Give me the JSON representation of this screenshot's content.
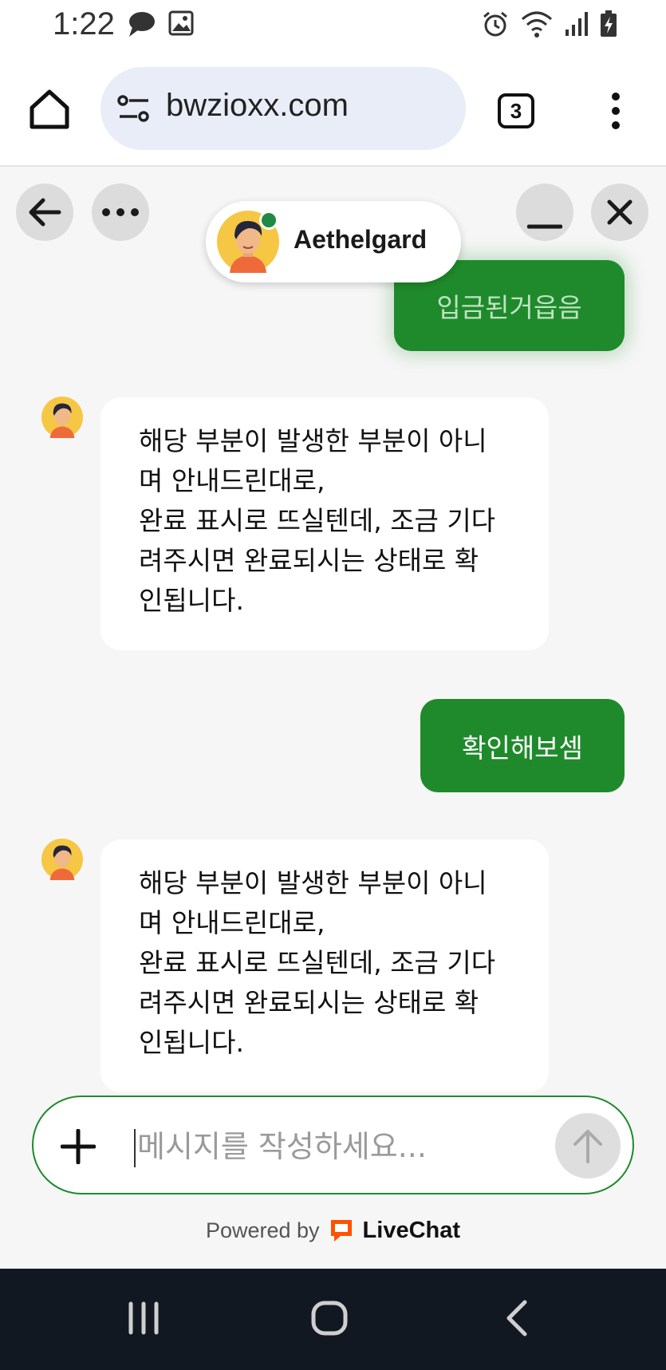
{
  "status_bar": {
    "time": "1:22",
    "left_icons": [
      "chat-bubble-icon",
      "image-icon"
    ],
    "right_icons": [
      "alarm-icon",
      "wifi-icon",
      "signal-icon",
      "battery-charging-icon"
    ]
  },
  "browser": {
    "url": "bwzioxx.com",
    "tab_count": "3"
  },
  "chat": {
    "agent_name": "Aethelgard",
    "agent_online": true,
    "messages": [
      {
        "from": "user",
        "text": "입금된거읍음"
      },
      {
        "from": "agent",
        "lines": [
          "해당 부분이 발생한 부분이 아니",
          "며 안내드린대로,",
          "완료 표시로 뜨실텐데, 조금 기다",
          "려주시면 완료되시는 상태로 확",
          "인됩니다."
        ]
      },
      {
        "from": "user",
        "text": "확인해보셈"
      },
      {
        "from": "agent",
        "lines": [
          "해당 부분이 발생한 부분이 아니",
          "며 안내드린대로,",
          "완료 표시로 뜨실텐데, 조금 기다",
          "려주시면 완료되시는 상태로 확",
          "인됩니다."
        ]
      }
    ]
  },
  "composer": {
    "placeholder": "메시지를 작성하세요...",
    "value": ""
  },
  "footer": {
    "powered_by": "Powered by",
    "brand": "LiveChat"
  },
  "colors": {
    "accent_green": "#1f8a2b",
    "online_green": "#1f8a43",
    "livechat_orange": "#ff5100",
    "navbar_bg": "#121822"
  }
}
